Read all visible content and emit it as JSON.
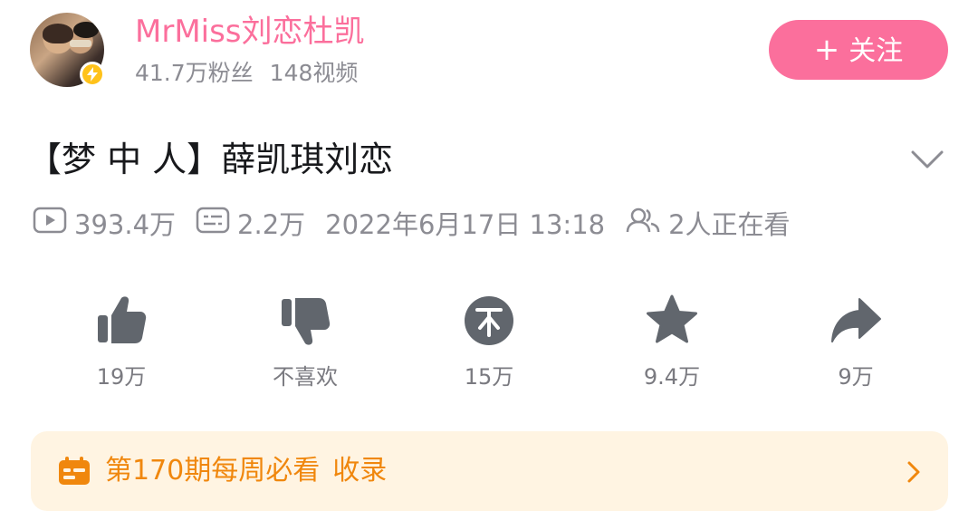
{
  "author": {
    "name": "MrMiss刘恋杜凯",
    "followers": "41.7万粉丝",
    "videos": "148视频",
    "follow_label": "关注"
  },
  "video": {
    "title": "【梦 中 人】薛凯琪刘恋",
    "views": "393.4万",
    "danmaku": "2.2万",
    "date": "2022年6月17日 13:18",
    "watching": "2人正在看"
  },
  "actions": {
    "like": "19万",
    "dislike": "不喜欢",
    "coin": "15万",
    "favorite": "9.4万",
    "share": "9万"
  },
  "collection": {
    "title": "第170期每周必看",
    "tag": "收录"
  },
  "colors": {
    "accent": "#fb6f9c",
    "banner_text": "#f0870d",
    "banner_bg": "#fff4e2",
    "icon": "#61666d",
    "meta": "#8c8c93"
  }
}
